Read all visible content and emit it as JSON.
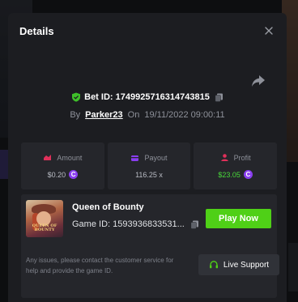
{
  "modal": {
    "title": "Details"
  },
  "bet": {
    "id_text": "Bet ID: 1749925716314743815",
    "by_label": "By",
    "username": "Parker23",
    "on_label": "On",
    "datetime": "19/11/2022 09:00:11"
  },
  "stats": [
    {
      "label": "Amount",
      "value": "$0.20",
      "icon": "amount-icon",
      "color": "#e0305a"
    },
    {
      "label": "Payout",
      "value": "116.25 x",
      "icon": "payout-icon",
      "color": "#8a3ef0"
    },
    {
      "label": "Profit",
      "value": "$23.05",
      "icon": "profit-icon",
      "color": "#e0305a"
    }
  ],
  "coin_symbol": "C",
  "game": {
    "name": "Queen of Bounty",
    "id_text": "Game ID: 1593936833531...",
    "thumb_title": "QUEEN OF BOUNTY",
    "play_label": "Play Now"
  },
  "support": {
    "note": "Any issues, please contact the customer service for help and provide the game ID.",
    "button_label": "Live Support"
  },
  "colors": {
    "accent_green": "#4fd017",
    "profit_green": "#48d93a",
    "coin_purple": "#8a3ef0",
    "modal_bg": "#1c1d21",
    "card_bg": "#25262b"
  }
}
